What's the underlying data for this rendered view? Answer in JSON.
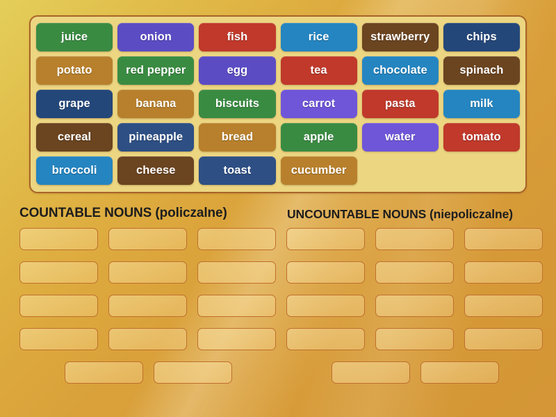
{
  "background": {
    "gradient_from": "#e4ce5a",
    "gradient_to": "#d49636"
  },
  "word_bank": {
    "panel_color": "#ecd682",
    "border_color": "#a8642a",
    "rows": [
      [
        {
          "label": "juice",
          "color": "#3a8b42"
        },
        {
          "label": "onion",
          "color": "#5b4cc4"
        },
        {
          "label": "fish",
          "color": "#c0392b"
        },
        {
          "label": "rice",
          "color": "#2585c0"
        },
        {
          "label": "strawberry",
          "color": "#6b4420"
        },
        {
          "label": "chips",
          "color": "#24477a"
        }
      ],
      [
        {
          "label": "potato",
          "color": "#b8802c"
        },
        {
          "label": "red pepper",
          "color": "#3a8b42"
        },
        {
          "label": "egg",
          "color": "#5b4cc4"
        },
        {
          "label": "tea",
          "color": "#c0392b"
        },
        {
          "label": "chocolate",
          "color": "#2585c0"
        },
        {
          "label": "spinach",
          "color": "#6b4420"
        }
      ],
      [
        {
          "label": "grape",
          "color": "#24477a"
        },
        {
          "label": "banana",
          "color": "#b8802c"
        },
        {
          "label": "biscuits",
          "color": "#3a8b42"
        },
        {
          "label": "carrot",
          "color": "#6f56d8"
        },
        {
          "label": "pasta",
          "color": "#c0392b"
        },
        {
          "label": "milk",
          "color": "#2585c0"
        }
      ],
      [
        {
          "label": "cereal",
          "color": "#6b4420"
        },
        {
          "label": "pineapple",
          "color": "#2d4f84"
        },
        {
          "label": "bread",
          "color": "#b8802c"
        },
        {
          "label": "apple",
          "color": "#3a8b42"
        },
        {
          "label": "water",
          "color": "#6f56d8"
        },
        {
          "label": "tomato",
          "color": "#c0392b"
        }
      ],
      [
        {
          "label": "broccoli",
          "color": "#2585c0"
        },
        {
          "label": "cheese",
          "color": "#6b4420"
        },
        {
          "label": "toast",
          "color": "#2d4f84"
        },
        {
          "label": "cucumber",
          "color": "#b8802c"
        }
      ]
    ]
  },
  "columns": [
    {
      "id": "countable",
      "heading": "COUNTABLE NOUNS (policzalne)",
      "slot_rows": [
        3,
        3,
        3,
        3,
        2
      ]
    },
    {
      "id": "uncountable",
      "heading": "UNCOUNTABLE NOUNS (niepoliczalne)",
      "slot_rows": [
        3,
        3,
        3,
        3,
        2
      ]
    }
  ]
}
